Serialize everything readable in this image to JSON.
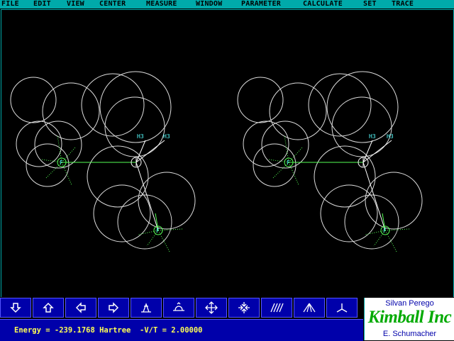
{
  "menu": {
    "items": [
      {
        "label": "FILE",
        "name": "menu-file"
      },
      {
        "label": "EDIT",
        "name": "menu-edit"
      },
      {
        "label": "VIEW",
        "name": "menu-view"
      },
      {
        "label": "CENTER",
        "name": "menu-center"
      },
      {
        "label": "MEASURE",
        "name": "menu-measure"
      },
      {
        "label": "WINDOW",
        "name": "menu-window"
      },
      {
        "label": "PARAMETER",
        "name": "menu-parameter"
      },
      {
        "label": "CALCULATE",
        "name": "menu-calculate"
      },
      {
        "label": "SET",
        "name": "menu-set"
      },
      {
        "label": "TRACE",
        "name": "menu-trace"
      }
    ]
  },
  "toolbar": {
    "buttons": [
      {
        "name": "move-down-button",
        "icon": "arrow-down-icon"
      },
      {
        "name": "move-up-button",
        "icon": "arrow-up-icon"
      },
      {
        "name": "move-left-button",
        "icon": "arrow-left-icon"
      },
      {
        "name": "move-right-button",
        "icon": "arrow-right-icon"
      },
      {
        "name": "rotate-up-button",
        "icon": "rotate-up-icon"
      },
      {
        "name": "rotate-down-button",
        "icon": "rotate-down-icon"
      },
      {
        "name": "expand-button",
        "icon": "expand-arrows-icon"
      },
      {
        "name": "contract-button",
        "icon": "contract-arrows-icon"
      },
      {
        "name": "hatch-button",
        "icon": "hatch-lines-icon"
      },
      {
        "name": "perspective-button",
        "icon": "perspective-icon"
      },
      {
        "name": "axes-button",
        "icon": "axes-icon"
      }
    ]
  },
  "status": {
    "text": "Energy = -239.1768 Hartree  -V/T = 2.00000"
  },
  "logo": {
    "top": "Silvan Perego",
    "brand": "Kimball Inc",
    "bottom": "E. Schumacher"
  },
  "molecule": {
    "labels": {
      "h_left": "H3",
      "h_right": "H3",
      "f": "F"
    },
    "colors": {
      "sphere": "#dddddd",
      "bond_white": "#ffffff",
      "bond_green": "#55ff55",
      "fluorine": "#55ff55",
      "hydrogen_label": "#55ffff"
    }
  },
  "colors": {
    "menubar": "#00aaaa",
    "toolbar": "#0000aa",
    "status_text": "#ffff55",
    "logo_brand": "#00aa00",
    "logo_text": "#0000aa"
  }
}
